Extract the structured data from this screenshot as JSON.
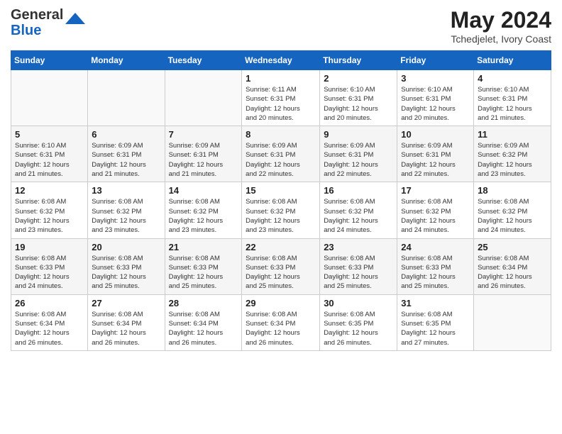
{
  "logo": {
    "general": "General",
    "blue": "Blue"
  },
  "title": "May 2024",
  "location": "Tchedjelet, Ivory Coast",
  "days_of_week": [
    "Sunday",
    "Monday",
    "Tuesday",
    "Wednesday",
    "Thursday",
    "Friday",
    "Saturday"
  ],
  "weeks": [
    [
      {
        "day": "",
        "info": ""
      },
      {
        "day": "",
        "info": ""
      },
      {
        "day": "",
        "info": ""
      },
      {
        "day": "1",
        "info": "Sunrise: 6:11 AM\nSunset: 6:31 PM\nDaylight: 12 hours\nand 20 minutes."
      },
      {
        "day": "2",
        "info": "Sunrise: 6:10 AM\nSunset: 6:31 PM\nDaylight: 12 hours\nand 20 minutes."
      },
      {
        "day": "3",
        "info": "Sunrise: 6:10 AM\nSunset: 6:31 PM\nDaylight: 12 hours\nand 20 minutes."
      },
      {
        "day": "4",
        "info": "Sunrise: 6:10 AM\nSunset: 6:31 PM\nDaylight: 12 hours\nand 21 minutes."
      }
    ],
    [
      {
        "day": "5",
        "info": "Sunrise: 6:10 AM\nSunset: 6:31 PM\nDaylight: 12 hours\nand 21 minutes."
      },
      {
        "day": "6",
        "info": "Sunrise: 6:09 AM\nSunset: 6:31 PM\nDaylight: 12 hours\nand 21 minutes."
      },
      {
        "day": "7",
        "info": "Sunrise: 6:09 AM\nSunset: 6:31 PM\nDaylight: 12 hours\nand 21 minutes."
      },
      {
        "day": "8",
        "info": "Sunrise: 6:09 AM\nSunset: 6:31 PM\nDaylight: 12 hours\nand 22 minutes."
      },
      {
        "day": "9",
        "info": "Sunrise: 6:09 AM\nSunset: 6:31 PM\nDaylight: 12 hours\nand 22 minutes."
      },
      {
        "day": "10",
        "info": "Sunrise: 6:09 AM\nSunset: 6:31 PM\nDaylight: 12 hours\nand 22 minutes."
      },
      {
        "day": "11",
        "info": "Sunrise: 6:09 AM\nSunset: 6:32 PM\nDaylight: 12 hours\nand 23 minutes."
      }
    ],
    [
      {
        "day": "12",
        "info": "Sunrise: 6:08 AM\nSunset: 6:32 PM\nDaylight: 12 hours\nand 23 minutes."
      },
      {
        "day": "13",
        "info": "Sunrise: 6:08 AM\nSunset: 6:32 PM\nDaylight: 12 hours\nand 23 minutes."
      },
      {
        "day": "14",
        "info": "Sunrise: 6:08 AM\nSunset: 6:32 PM\nDaylight: 12 hours\nand 23 minutes."
      },
      {
        "day": "15",
        "info": "Sunrise: 6:08 AM\nSunset: 6:32 PM\nDaylight: 12 hours\nand 23 minutes."
      },
      {
        "day": "16",
        "info": "Sunrise: 6:08 AM\nSunset: 6:32 PM\nDaylight: 12 hours\nand 24 minutes."
      },
      {
        "day": "17",
        "info": "Sunrise: 6:08 AM\nSunset: 6:32 PM\nDaylight: 12 hours\nand 24 minutes."
      },
      {
        "day": "18",
        "info": "Sunrise: 6:08 AM\nSunset: 6:32 PM\nDaylight: 12 hours\nand 24 minutes."
      }
    ],
    [
      {
        "day": "19",
        "info": "Sunrise: 6:08 AM\nSunset: 6:33 PM\nDaylight: 12 hours\nand 24 minutes."
      },
      {
        "day": "20",
        "info": "Sunrise: 6:08 AM\nSunset: 6:33 PM\nDaylight: 12 hours\nand 25 minutes."
      },
      {
        "day": "21",
        "info": "Sunrise: 6:08 AM\nSunset: 6:33 PM\nDaylight: 12 hours\nand 25 minutes."
      },
      {
        "day": "22",
        "info": "Sunrise: 6:08 AM\nSunset: 6:33 PM\nDaylight: 12 hours\nand 25 minutes."
      },
      {
        "day": "23",
        "info": "Sunrise: 6:08 AM\nSunset: 6:33 PM\nDaylight: 12 hours\nand 25 minutes."
      },
      {
        "day": "24",
        "info": "Sunrise: 6:08 AM\nSunset: 6:33 PM\nDaylight: 12 hours\nand 25 minutes."
      },
      {
        "day": "25",
        "info": "Sunrise: 6:08 AM\nSunset: 6:34 PM\nDaylight: 12 hours\nand 26 minutes."
      }
    ],
    [
      {
        "day": "26",
        "info": "Sunrise: 6:08 AM\nSunset: 6:34 PM\nDaylight: 12 hours\nand 26 minutes."
      },
      {
        "day": "27",
        "info": "Sunrise: 6:08 AM\nSunset: 6:34 PM\nDaylight: 12 hours\nand 26 minutes."
      },
      {
        "day": "28",
        "info": "Sunrise: 6:08 AM\nSunset: 6:34 PM\nDaylight: 12 hours\nand 26 minutes."
      },
      {
        "day": "29",
        "info": "Sunrise: 6:08 AM\nSunset: 6:34 PM\nDaylight: 12 hours\nand 26 minutes."
      },
      {
        "day": "30",
        "info": "Sunrise: 6:08 AM\nSunset: 6:35 PM\nDaylight: 12 hours\nand 26 minutes."
      },
      {
        "day": "31",
        "info": "Sunrise: 6:08 AM\nSunset: 6:35 PM\nDaylight: 12 hours\nand 27 minutes."
      },
      {
        "day": "",
        "info": ""
      }
    ]
  ]
}
